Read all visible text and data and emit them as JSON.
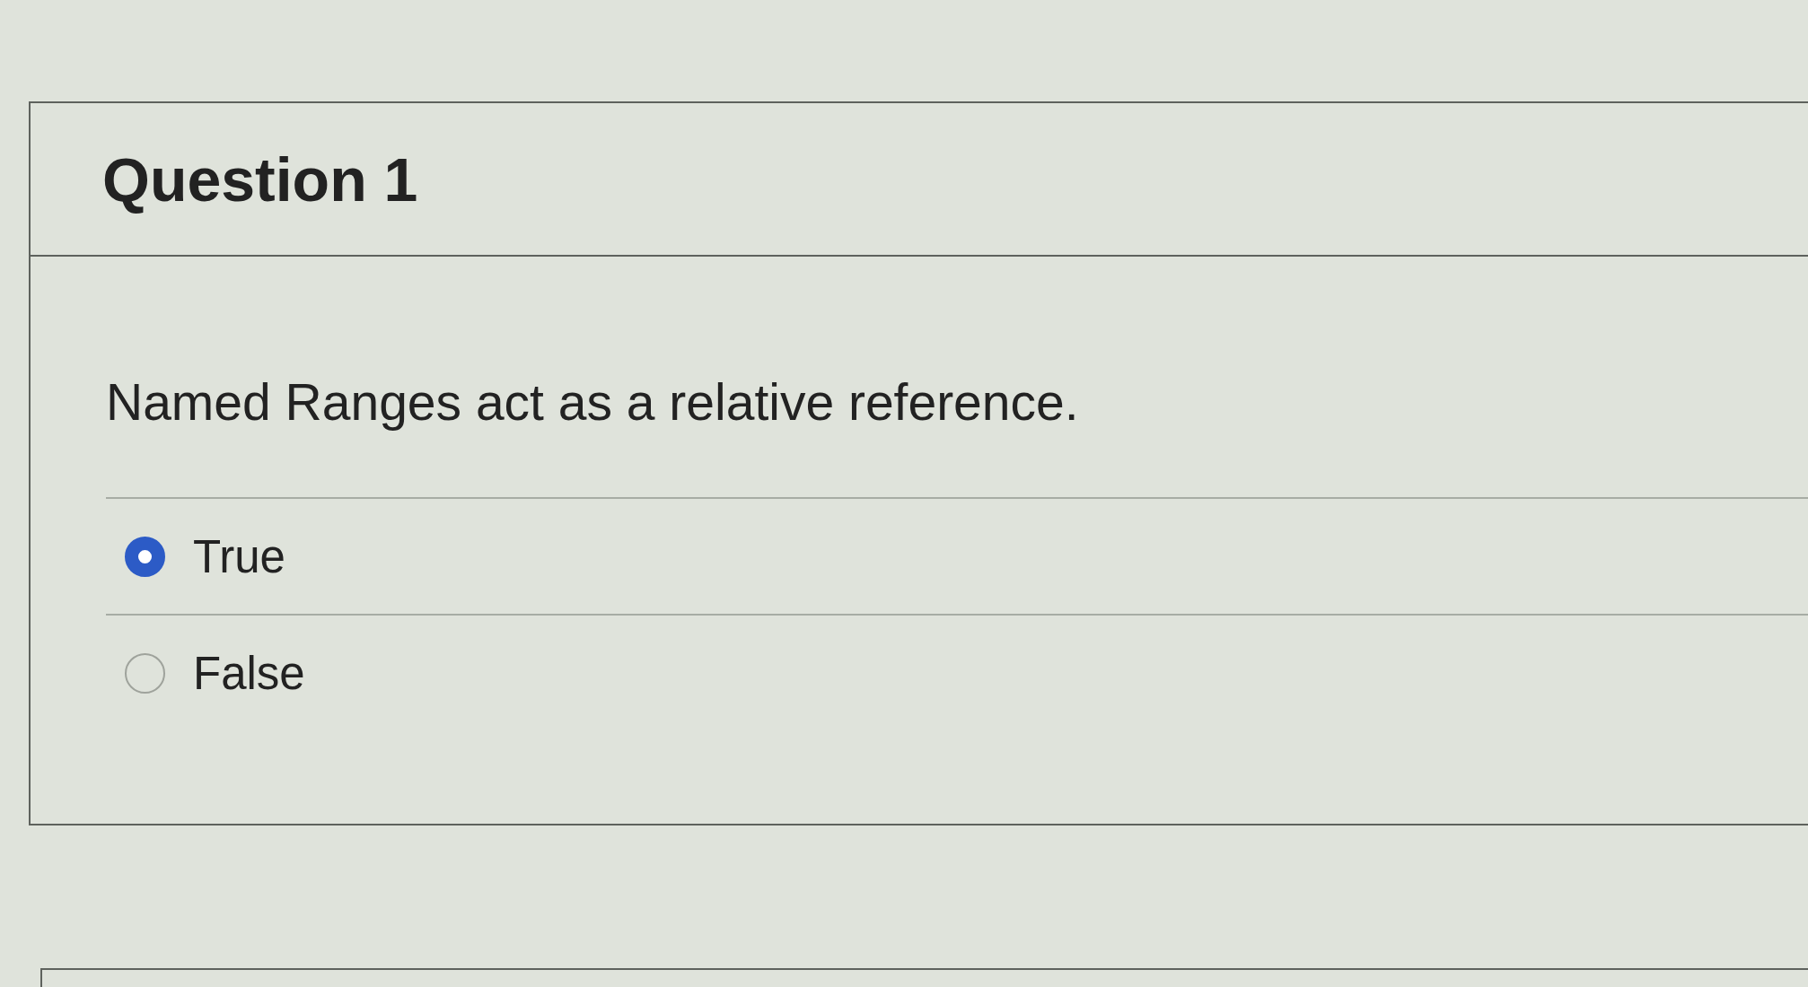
{
  "question": {
    "title": "Question 1",
    "text": "Named Ranges act as a relative reference.",
    "options": [
      {
        "label": "True",
        "selected": true
      },
      {
        "label": "False",
        "selected": false
      }
    ]
  }
}
